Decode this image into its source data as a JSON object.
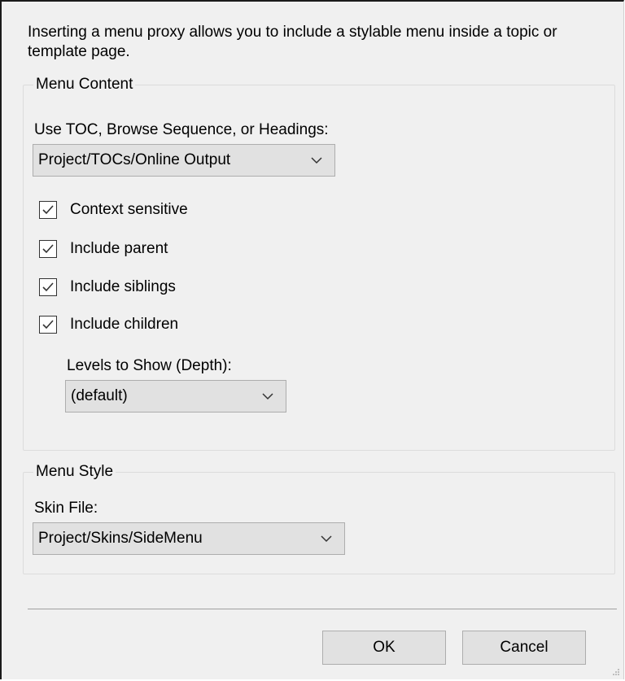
{
  "intro_text": "Inserting a menu proxy allows you to include a stylable menu inside a topic or template page.",
  "menu_content": {
    "legend": "Menu Content",
    "source_label": "Use TOC, Browse Sequence, or Headings:",
    "source_value": "Project/TOCs/Online Output",
    "checkboxes": [
      {
        "label": "Context sensitive",
        "checked": true
      },
      {
        "label": "Include parent",
        "checked": true
      },
      {
        "label": "Include siblings",
        "checked": true
      },
      {
        "label": "Include children",
        "checked": true
      }
    ],
    "depth_label": "Levels to Show (Depth):",
    "depth_value": "(default)"
  },
  "menu_style": {
    "legend": "Menu Style",
    "skin_label": "Skin File:",
    "skin_value": "Project/Skins/SideMenu"
  },
  "buttons": {
    "ok": "OK",
    "cancel": "Cancel"
  },
  "icons": {
    "dropdown": "chevron-down-icon",
    "checkmark": "checkmark-icon",
    "resize": "resize-grip-icon"
  }
}
